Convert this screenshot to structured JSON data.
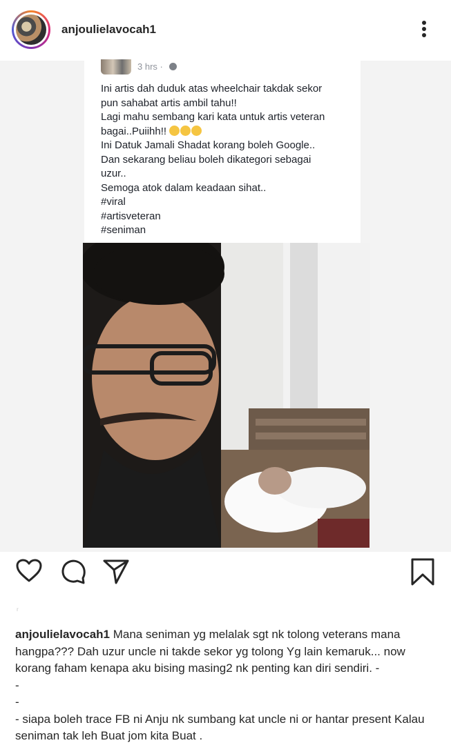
{
  "header": {
    "username": "anjoulielavocah1",
    "avatar_icon": "profile-avatar",
    "more_icon": "more-vertical-icon"
  },
  "facebook_post": {
    "time": "3 hrs · ",
    "lines": [
      "Ini artis dah duduk atas wheelchair takdak sekor",
      "pun sahabat artis ambil tahu!!",
      "Lagi mahu sembang kari kata untuk artis veteran",
      "bagai..Puiihh!!",
      "Ini Datuk Jamali Shadat korang boleh Google..",
      "Dan sekarang beliau boleh dikategori sebagai",
      "uzur..",
      "Semoga atok dalam keadaan sihat..",
      "#viral",
      "#artisveteran",
      "#seniman"
    ]
  },
  "actions": {
    "like_icon": "heart-icon",
    "comment_icon": "comment-icon",
    "share_icon": "send-icon",
    "save_icon": "bookmark-icon"
  },
  "caption": {
    "username": "anjoulielavocah1",
    "line1_text": " Mana seniman yg melalak sgt nk tolong veterans mana",
    "line2": "hangpa??? Dah uzur uncle ni takde sekor yg tolong Yg lain kemaruk... now",
    "line3": "korang faham kenapa aku bising masing2 nk penting kan diri sendiri. -",
    "line4": "-",
    "line5": "-",
    "line6": "- siapa boleh trace FB ni Anju nk sumbang kat uncle ni or hantar present Kalau",
    "line7": "seniman tak leh Buat jom kita Buat ."
  },
  "colors": {
    "accent_ring": "#dd2a7b",
    "text": "#262626",
    "fb_meta": "#90949c"
  }
}
